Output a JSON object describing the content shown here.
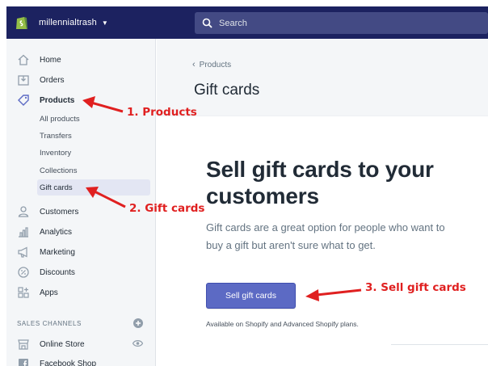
{
  "topbar": {
    "store_name": "millennialtrash",
    "search_placeholder": "Search"
  },
  "sidebar": {
    "items": [
      {
        "label": "Home",
        "icon": "home-icon"
      },
      {
        "label": "Orders",
        "icon": "orders-icon"
      },
      {
        "label": "Products",
        "icon": "tag-icon"
      },
      {
        "label": "Customers",
        "icon": "customers-icon"
      },
      {
        "label": "Analytics",
        "icon": "analytics-icon"
      },
      {
        "label": "Marketing",
        "icon": "megaphone-icon"
      },
      {
        "label": "Discounts",
        "icon": "discount-icon"
      },
      {
        "label": "Apps",
        "icon": "apps-icon"
      }
    ],
    "product_subitems": [
      "All products",
      "Transfers",
      "Inventory",
      "Collections",
      "Gift cards"
    ],
    "sales_channels_title": "SALES CHANNELS",
    "channels": [
      {
        "label": "Online Store",
        "icon": "store-icon"
      },
      {
        "label": "Facebook Shop",
        "icon": "facebook-icon"
      }
    ]
  },
  "main": {
    "back_label": "Products",
    "page_title": "Gift cards",
    "hero_title": "Sell gift cards to your customers",
    "hero_description": "Gift cards are a great option for people who want to buy a gift but aren't sure what to get.",
    "button_label": "Sell gift cards",
    "availability_note": "Available on Shopify and Advanced Shopify plans."
  },
  "annotations": {
    "step1": "1. Products",
    "step2": "2. Gift cards",
    "step3": "3. Sell gift cards"
  },
  "colors": {
    "topbar": "#1c2260",
    "button": "#5c6ac4",
    "annotation": "#e02020",
    "active_subitem": "#e3e6f3"
  }
}
